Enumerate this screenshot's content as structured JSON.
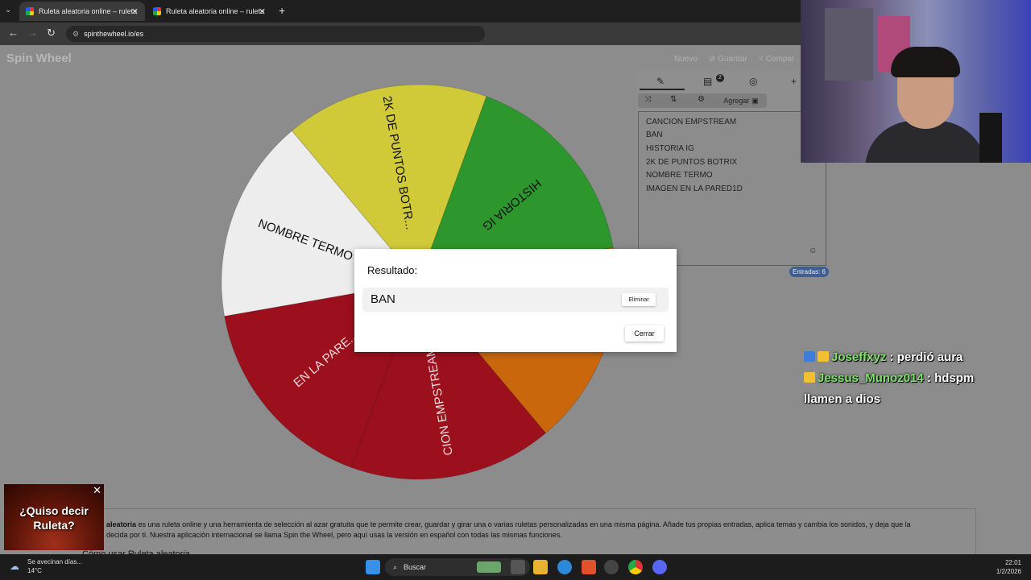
{
  "browser": {
    "tabs": [
      {
        "title": "Ruleta aleatoria online – ruleta"
      },
      {
        "title": "Ruleta aleatoria online – ruleta"
      }
    ],
    "url": "spinthewheel.io/es"
  },
  "header": {
    "logo": "Spin Wheel",
    "links": [
      "Nuevo",
      "Guardar",
      "Compar"
    ]
  },
  "editor": {
    "clipboard_count": "2",
    "add_label": "Agregar",
    "entries": [
      "CANCION EMPSTREAM",
      "BAN",
      "HISTORIA IG",
      "2K DE PUNTOS BOTRIX",
      "NOMBRE TERMO",
      "IMAGEN EN LA PARED1D"
    ],
    "entries_badge": "Entradas: 6"
  },
  "wheel": {
    "segments": [
      {
        "label": "HISTORIA IG",
        "color": "#2e9a2e"
      },
      {
        "label": "",
        "color": "#cf6a0e"
      },
      {
        "label": "CION EMPSTREAM",
        "color": "#a0101e"
      },
      {
        "label": "EN LA PARE...",
        "color": "#a0101e"
      },
      {
        "label": "NOMBRE TERMO",
        "color": "#f2f2f2"
      },
      {
        "label": "2K DE PUNTOS BOTR...",
        "color": "#d6cf3a"
      }
    ]
  },
  "dialog": {
    "title": "Resultado:",
    "result": "BAN",
    "remove_label": "Eliminar",
    "close_label": "Cerrar"
  },
  "description": {
    "bold": "aleatoria",
    "text": " es una ruleta online y una herramienta de selección al azar gratuita que te permite crear, guardar y girar una o varias ruletas personalizadas en una misma página. Añade tus propias entradas, aplica temas y cambia los sonidos, y deja que la",
    "text2": "decida por ti. Nuestra aplicación internacional se llama Spin the Wheel, pero aquí usas la versión en español con todas las mismas funciones.",
    "heading": "Cómo usar Ruleta aleatoria"
  },
  "chat": [
    {
      "user": "Joseffxyz",
      "message": ": perdió aura"
    },
    {
      "user": "Jessus_Munoz014",
      "message": ": hdspm llamen a dios"
    }
  ],
  "promo": {
    "line1": "¿Quiso decir",
    "line2": "Ruleta?"
  },
  "taskbar": {
    "weather_title": "Se avecinan días...",
    "weather_temp": "14°C",
    "search": "Buscar",
    "time": "22:01",
    "date": "1/2/2026"
  }
}
